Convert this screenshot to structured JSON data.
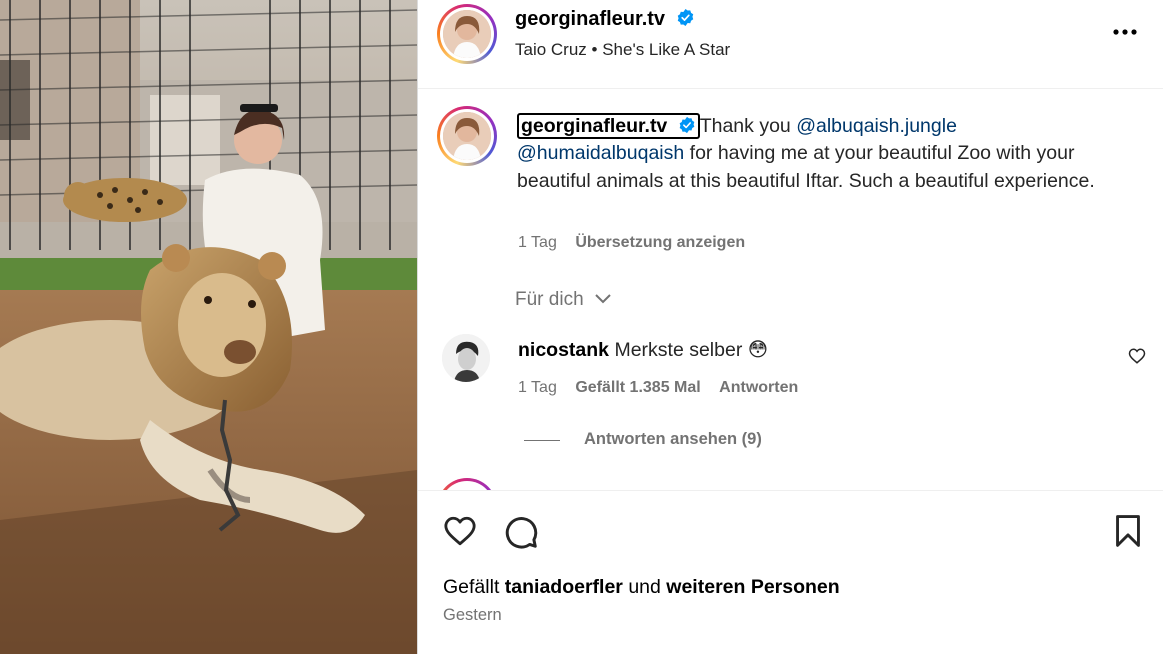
{
  "post": {
    "username": "georginafleur.tv",
    "song": "Taio Cruz • She's Like A Star"
  },
  "caption": {
    "username": "georginafleur.tv",
    "part1": "Thank you ",
    "mention1": "@albuqaish.jungle",
    "mention2": "@humaidalbuqaish",
    "part2": " for having me at your beautiful Zoo with your beautiful animals at this beautiful Iftar. Such a beautiful experience.",
    "age": "1 Tag",
    "translate": "Übersetzung anzeigen"
  },
  "filter_label": "Für dich",
  "comment": {
    "username": "nicostank",
    "text": "Merkste selber",
    "emoji": "😳",
    "age": "1 Tag",
    "likes": "Gefällt 1.385 Mal",
    "reply": "Antworten",
    "view_replies": "Antworten ansehen (9)"
  },
  "footer": {
    "likes_prefix": "Gefällt",
    "liked_by": "taniadoerfler",
    "likes_mid": "und",
    "likes_rest": "weiteren Personen",
    "date": "Gestern"
  },
  "icons": {
    "verified": "verified-badge-icon",
    "more": "more-options-icon",
    "chevron": "chevron-down-icon",
    "heart": "heart-icon",
    "comment": "comment-icon",
    "save": "bookmark-icon"
  },
  "colors": {
    "verified": "#0095f6",
    "mention": "#00376b",
    "secondary_text": "#737373"
  }
}
